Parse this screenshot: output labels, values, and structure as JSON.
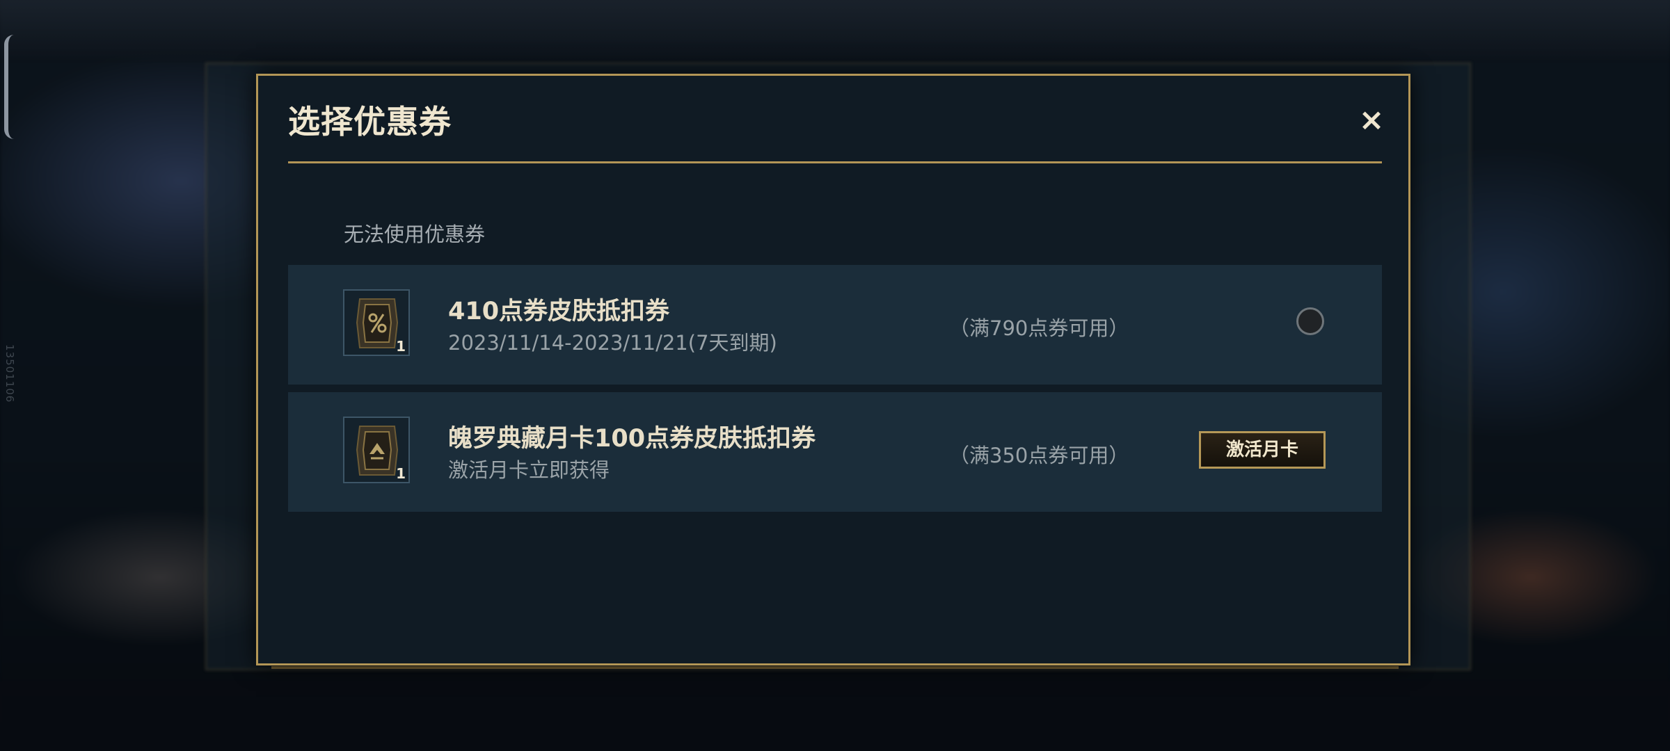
{
  "dialog": {
    "title": "选择优惠券",
    "close_icon": "×",
    "section_label": "无法使用优惠券"
  },
  "coupons": [
    {
      "name": "410点券皮肤抵扣券",
      "subtitle": "2023/11/14-2023/11/21(7天到期)",
      "condition": "（满790点券可用）",
      "count": "1",
      "action": "radio"
    },
    {
      "name": "魄罗典藏月卡100点券皮肤抵扣券",
      "subtitle": "激活月卡立即获得",
      "condition": "（满350点券可用）",
      "count": "1",
      "action_label": "激活月卡"
    }
  ],
  "edge": {
    "code": "13501106"
  },
  "colors": {
    "accent_gold": "#b39656",
    "dialog_bg": "#101b24",
    "row_bg": "#1b2d3a"
  }
}
